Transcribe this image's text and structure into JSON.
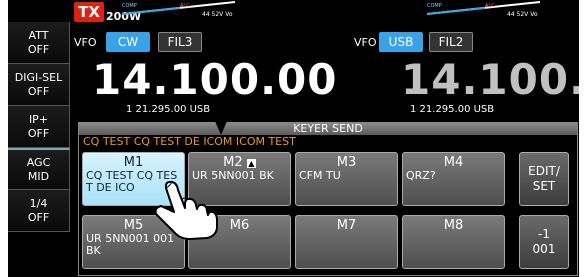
{
  "sidebar": [
    {
      "top": "ATT",
      "bottom": "OFF"
    },
    {
      "top": "DIGI-SEL",
      "bottom": "OFF"
    },
    {
      "top": "IP+",
      "bottom": "OFF"
    },
    {
      "top": "AGC",
      "bottom": "MID"
    },
    {
      "top": "1/4",
      "bottom": "OFF"
    }
  ],
  "tx": {
    "badge": "TX",
    "power": "200W"
  },
  "meter": {
    "left": "COMP  ALC  44 52V Vo",
    "right": "COMP  ALC  44 52V Vo"
  },
  "vfo_main": {
    "label": "VFO",
    "mode": "CW",
    "filter": "FIL3",
    "frequency": "14.100.00",
    "sub": "1  21.295.00  USB"
  },
  "vfo_sub": {
    "label": "VFO",
    "mode": "USB",
    "filter": "FIL2",
    "frequency": "14.100.00",
    "sub": "1  21.295.00  USB"
  },
  "keyer": {
    "title": "KEYER SEND",
    "sending": "CQ TEST CQ TEST DE ICOM ICOM TEST",
    "memories": [
      {
        "name": "M1",
        "text": "CQ TEST CQ TEST DE ICO"
      },
      {
        "name": "M2",
        "text": "UR 5NN001 BK"
      },
      {
        "name": "M3",
        "text": "CFM TU"
      },
      {
        "name": "M4",
        "text": "QRZ?"
      },
      {
        "name": "M5",
        "text": "UR 5NN001 001 BK"
      },
      {
        "name": "M6",
        "text": ""
      },
      {
        "name": "M7",
        "text": ""
      },
      {
        "name": "M8",
        "text": ""
      }
    ],
    "edit_label_1": "EDIT/",
    "edit_label_2": "SET",
    "counter_label_1": "-1",
    "counter_label_2": "001"
  },
  "icons": {
    "pointer": "hand-pointer-icon",
    "callout": "arrow-callout"
  }
}
